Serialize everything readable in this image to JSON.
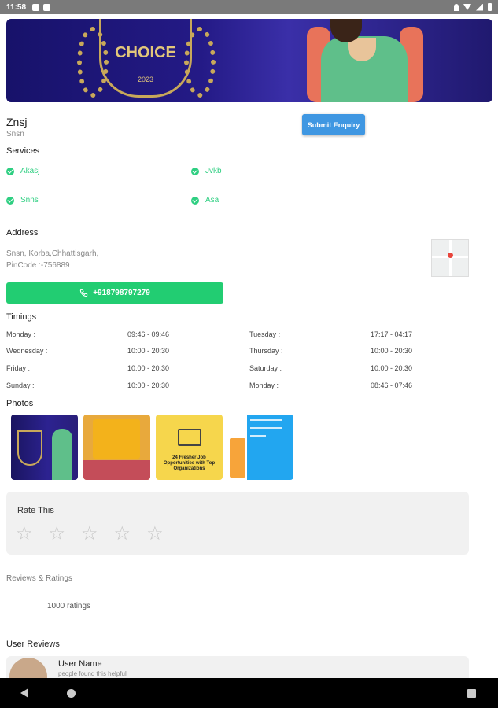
{
  "status_bar": {
    "time": "11:58"
  },
  "banner": {
    "badge_text": "CHOICE",
    "badge_year": "2023"
  },
  "business": {
    "name": "Znsj",
    "subtitle": "Snsn"
  },
  "actions": {
    "enquiry_label": "Submit Enquiry",
    "call_label": "+918798797279"
  },
  "services": {
    "title": "Services",
    "items": [
      "Akasj",
      "Jvkb",
      "Snns",
      "Asa"
    ]
  },
  "address": {
    "title": "Address",
    "line1": "Snsn, Korba,Chhattisgarh,",
    "line2": "PinCode :-756889"
  },
  "timings": {
    "title": "Timings",
    "rows": [
      {
        "day": "Monday :",
        "hours": "09:46 - 09:46"
      },
      {
        "day": "Tuesday :",
        "hours": "17:17 - 04:17"
      },
      {
        "day": "Wednesday :",
        "hours": "10:00 - 20:30"
      },
      {
        "day": "Thursday :",
        "hours": "10:00 - 20:30"
      },
      {
        "day": "Friday :",
        "hours": "10:00 - 20:30"
      },
      {
        "day": "Saturday :",
        "hours": "10:00 - 20:30"
      },
      {
        "day": "Sunday :",
        "hours": "10:00 - 20:30"
      },
      {
        "day": "Monday :",
        "hours": "08:46 - 07:46"
      }
    ]
  },
  "photos": {
    "title": "Photos",
    "job_post_caption": "24 Fresher Job Opportunities with Top Organizations"
  },
  "rating": {
    "title": "Rate This",
    "star_count": 5
  },
  "reviews": {
    "label": "Reviews & Ratings",
    "ratings_count": "1000 ratings",
    "user_reviews_title": "User Reviews",
    "first_review": {
      "user_name": "User Name",
      "helpful_text": "people found this helpful"
    }
  },
  "colors": {
    "accent_green": "#22cd72",
    "accent_blue": "#3f97e2"
  }
}
